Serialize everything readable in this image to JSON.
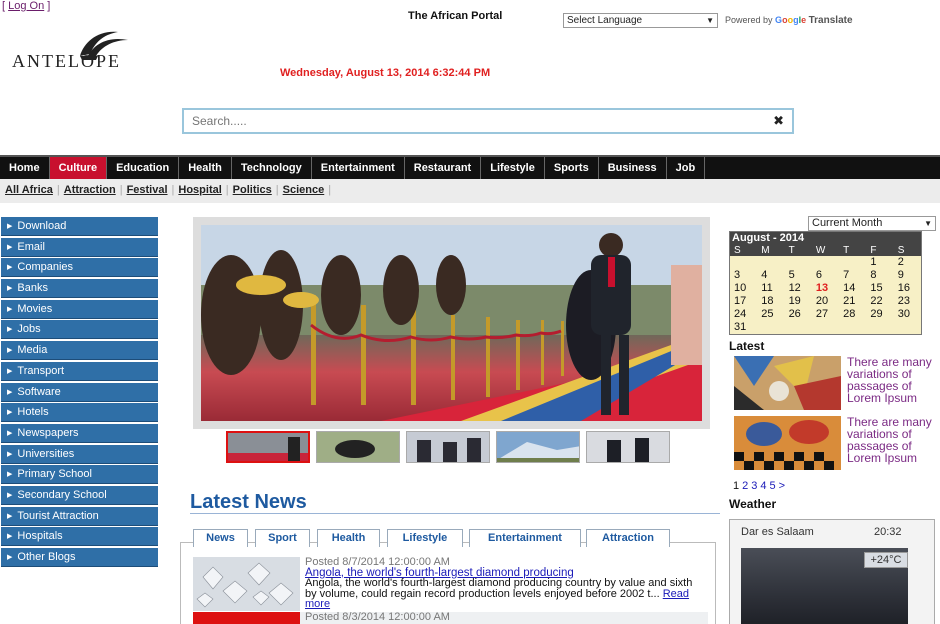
{
  "header": {
    "login_open": "[",
    "login_label": "Log On",
    "login_close": "]",
    "portal_title": "The African Portal",
    "language_select": "Select Language",
    "powered_by": "Powered by",
    "google": [
      "G",
      "o",
      "o",
      "g",
      "l",
      "e"
    ],
    "translate": "Translate",
    "logo_text": "ANTELOPE",
    "datetime": "Wednesday, August 13, 2014 6:32:44 PM"
  },
  "search": {
    "placeholder": "Search.....",
    "clear_icon": "✖"
  },
  "main_nav": [
    "Home",
    "Culture",
    "Education",
    "Health",
    "Technology",
    "Entertainment",
    "Restaurant",
    "Lifestyle",
    "Sports",
    "Business",
    "Job"
  ],
  "main_nav_active": "Culture",
  "sub_nav": [
    "All Africa",
    "Attraction",
    "Festival",
    "Hospital",
    "Politics",
    "Science"
  ],
  "sidebar": [
    "Download",
    "Email",
    "Companies",
    "Banks",
    "Movies",
    "Jobs",
    "Media",
    "Transport",
    "Software",
    "Hotels",
    "Newspapers",
    "Universities",
    "Primary School",
    "Secondary School",
    "Tourist Attraction",
    "Hospitals",
    "Other Blogs"
  ],
  "latest_news": {
    "heading": "Latest News",
    "tabs": [
      "News",
      "Sport",
      "Health",
      "Lifestyle",
      "Entertainment",
      "Attraction"
    ],
    "items": [
      {
        "meta": "Posted 8/7/2014 12:00:00 AM",
        "title": "Angola, the world's fourth-largest diamond producing",
        "summary": "Angola, the world's fourth-largest diamond producing country by value and sixth by volume, could regain record production levels enjoyed before 2002 t...",
        "read_more": "Read more"
      },
      {
        "meta": "Posted 8/3/2014 12:00:00 AM"
      }
    ]
  },
  "calendar": {
    "select": "Current Month",
    "title": "August - 2014",
    "dow": [
      "S",
      "M",
      "T",
      "W",
      "T",
      "F",
      "S"
    ],
    "weeks": [
      [
        "",
        "",
        "",
        "",
        "",
        "1",
        "2"
      ],
      [
        "3",
        "4",
        "5",
        "6",
        "7",
        "8",
        "9"
      ],
      [
        "10",
        "11",
        "12",
        "13",
        "14",
        "15",
        "16"
      ],
      [
        "17",
        "18",
        "19",
        "20",
        "21",
        "22",
        "23"
      ],
      [
        "24",
        "25",
        "26",
        "27",
        "28",
        "29",
        "30"
      ],
      [
        "31",
        "",
        "",
        "",
        "",
        "",
        ""
      ]
    ],
    "today": "13"
  },
  "latest": {
    "label": "Latest",
    "items": [
      {
        "text": "There are many variations of passages of Lorem Ipsum"
      },
      {
        "text": "There are many variations of passages of Lorem Ipsum"
      }
    ],
    "pager": [
      "1",
      "2",
      "3",
      "4",
      "5",
      ">"
    ]
  },
  "weather": {
    "label": "Weather",
    "city": "Dar es Salaam",
    "time": "20:32",
    "temp": "+24°C"
  },
  "colors": {
    "nav_active": "#c8102e",
    "sidebar_bg": "#2f6fa7",
    "heading_blue": "#1e5aa0",
    "date_red": "#e02020",
    "latest_purple": "#7b2a84"
  }
}
